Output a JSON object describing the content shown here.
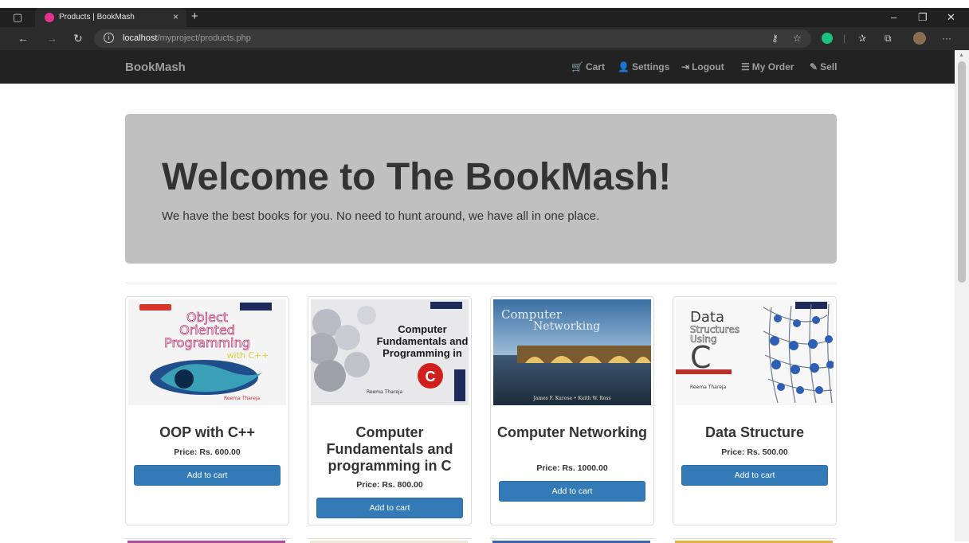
{
  "browser": {
    "tab_title": "Products | BookMash",
    "tab_close": "×",
    "new_tab": "+",
    "url_host": "localhost",
    "url_path": "/myproject/products.php"
  },
  "site": {
    "brand": "BookMash",
    "nav": [
      {
        "icon": "cart-icon",
        "glyph": "🛒",
        "label": "Cart"
      },
      {
        "icon": "user-icon",
        "glyph": "👤",
        "label": "Settings"
      },
      {
        "icon": "logout-icon",
        "glyph": "⇥",
        "label": "Logout"
      },
      {
        "icon": "list-icon",
        "glyph": "☰",
        "label": "My Order"
      },
      {
        "icon": "edit-icon",
        "glyph": "✎",
        "label": "Sell"
      }
    ]
  },
  "jumbotron": {
    "heading": "Welcome to The BookMash!",
    "tagline": "We have the best books for you. No need to hunt around, we have all in one place."
  },
  "products": [
    {
      "title": "OOP with C++",
      "price": "Price: Rs. 600.00",
      "button": "Add to cart",
      "cover_lines": [
        "Object",
        "Oriented",
        "Programming",
        "with C++"
      ],
      "cover_author": "Reema Thareja"
    },
    {
      "title": "Computer Fundamentals and programming in C",
      "price": "Price: Rs. 800.00",
      "button": "Add to cart",
      "cover_lines": [
        "Computer",
        "Fundamentals and",
        "Programming in"
      ],
      "cover_author": "Reema Thareja"
    },
    {
      "title": "Computer Networking",
      "price": "Price: Rs. 1000.00",
      "button": "Add to cart",
      "cover_lines": [
        "Computer",
        "Networking"
      ],
      "cover_author": "James F. Kurose • Keith W. Ross"
    },
    {
      "title": "Data Structure",
      "price": "Price: Rs. 500.00",
      "button": "Add to cart",
      "cover_lines": [
        "Data",
        "Structures",
        "Using",
        "C"
      ],
      "cover_author": "Reema Thareja"
    }
  ]
}
